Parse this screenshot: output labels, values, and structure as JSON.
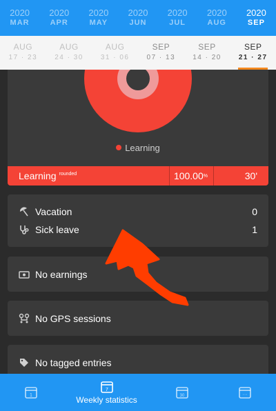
{
  "months": [
    {
      "year": "2020",
      "month": "MAR"
    },
    {
      "year": "2020",
      "month": "APR"
    },
    {
      "year": "2020",
      "month": "MAY"
    },
    {
      "year": "2020",
      "month": "JUN"
    },
    {
      "year": "2020",
      "month": "JUL"
    },
    {
      "year": "2020",
      "month": "AUG"
    },
    {
      "year": "2020",
      "month": "SEP",
      "active": true
    }
  ],
  "weeks": [
    {
      "month": "AUG",
      "days": "17 · 23"
    },
    {
      "month": "AUG",
      "days": "24 · 30"
    },
    {
      "month": "AUG",
      "days": "31 · 06"
    },
    {
      "month": "SEP",
      "days": "07 · 13"
    },
    {
      "month": "SEP",
      "days": "14 · 20"
    },
    {
      "month": "SEP",
      "days": "21 · 27",
      "active": true
    }
  ],
  "chart": {
    "legend_label": "Learning",
    "slice_color": "#f44336",
    "summary": {
      "name": "Learning",
      "name_tag": "rounded",
      "percent": "100.00",
      "percent_unit": "%",
      "duration": "30'"
    }
  },
  "leave": {
    "vacation_label": "Vacation",
    "vacation_value": "0",
    "sick_label": "Sick leave",
    "sick_value": "1"
  },
  "earnings_label": "No earnings",
  "gps_label": "No GPS sessions",
  "tags_label": "No tagged entries",
  "nav": {
    "day_icon_text": "1",
    "week_icon_text": "7",
    "week_label": "Weekly statistics",
    "month_icon_text": "30",
    "other_icon_text": "···"
  },
  "colors": {
    "primary": "#2196f3",
    "accent": "#f4891f",
    "chart_red": "#f44336",
    "annotation": "#ff3d00"
  }
}
